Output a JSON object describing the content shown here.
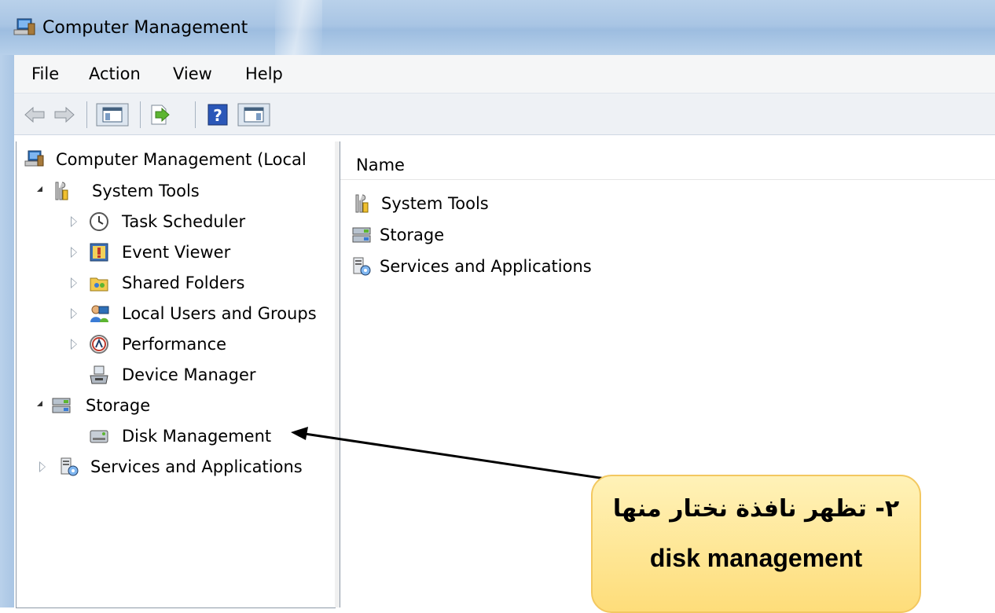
{
  "window": {
    "title": "Computer Management"
  },
  "menu": {
    "items": [
      "File",
      "Action",
      "View",
      "Help"
    ]
  },
  "toolbar": {
    "buttons": [
      "back-icon",
      "forward-icon",
      "show-hide-console-tree-icon",
      "export-list-icon",
      "help-icon",
      "show-hide-action-pane-icon"
    ]
  },
  "tree": {
    "root": "Computer Management (Local",
    "items": [
      {
        "label": "System Tools",
        "icon": "system-tools-icon",
        "state": "expanded"
      },
      {
        "label": "Task Scheduler",
        "icon": "clock-icon",
        "state": "collapsed"
      },
      {
        "label": "Event Viewer",
        "icon": "event-viewer-icon",
        "state": "collapsed"
      },
      {
        "label": "Shared Folders",
        "icon": "shared-folders-icon",
        "state": "collapsed"
      },
      {
        "label": "Local Users and Groups",
        "icon": "users-icon",
        "state": "collapsed"
      },
      {
        "label": "Performance",
        "icon": "performance-icon",
        "state": "collapsed"
      },
      {
        "label": "Device Manager",
        "icon": "device-manager-icon",
        "state": "leaf"
      },
      {
        "label": "Storage",
        "icon": "storage-icon",
        "state": "expanded"
      },
      {
        "label": "Disk Management",
        "icon": "disk-icon",
        "state": "leaf"
      },
      {
        "label": "Services and Applications",
        "icon": "services-icon",
        "state": "collapsed"
      }
    ]
  },
  "main": {
    "column_header": "Name",
    "items": [
      "System Tools",
      "Storage",
      "Services and Applications"
    ]
  },
  "callout": {
    "arabic": "٢- تظهر نافذة نختار منها",
    "english": "disk management"
  }
}
